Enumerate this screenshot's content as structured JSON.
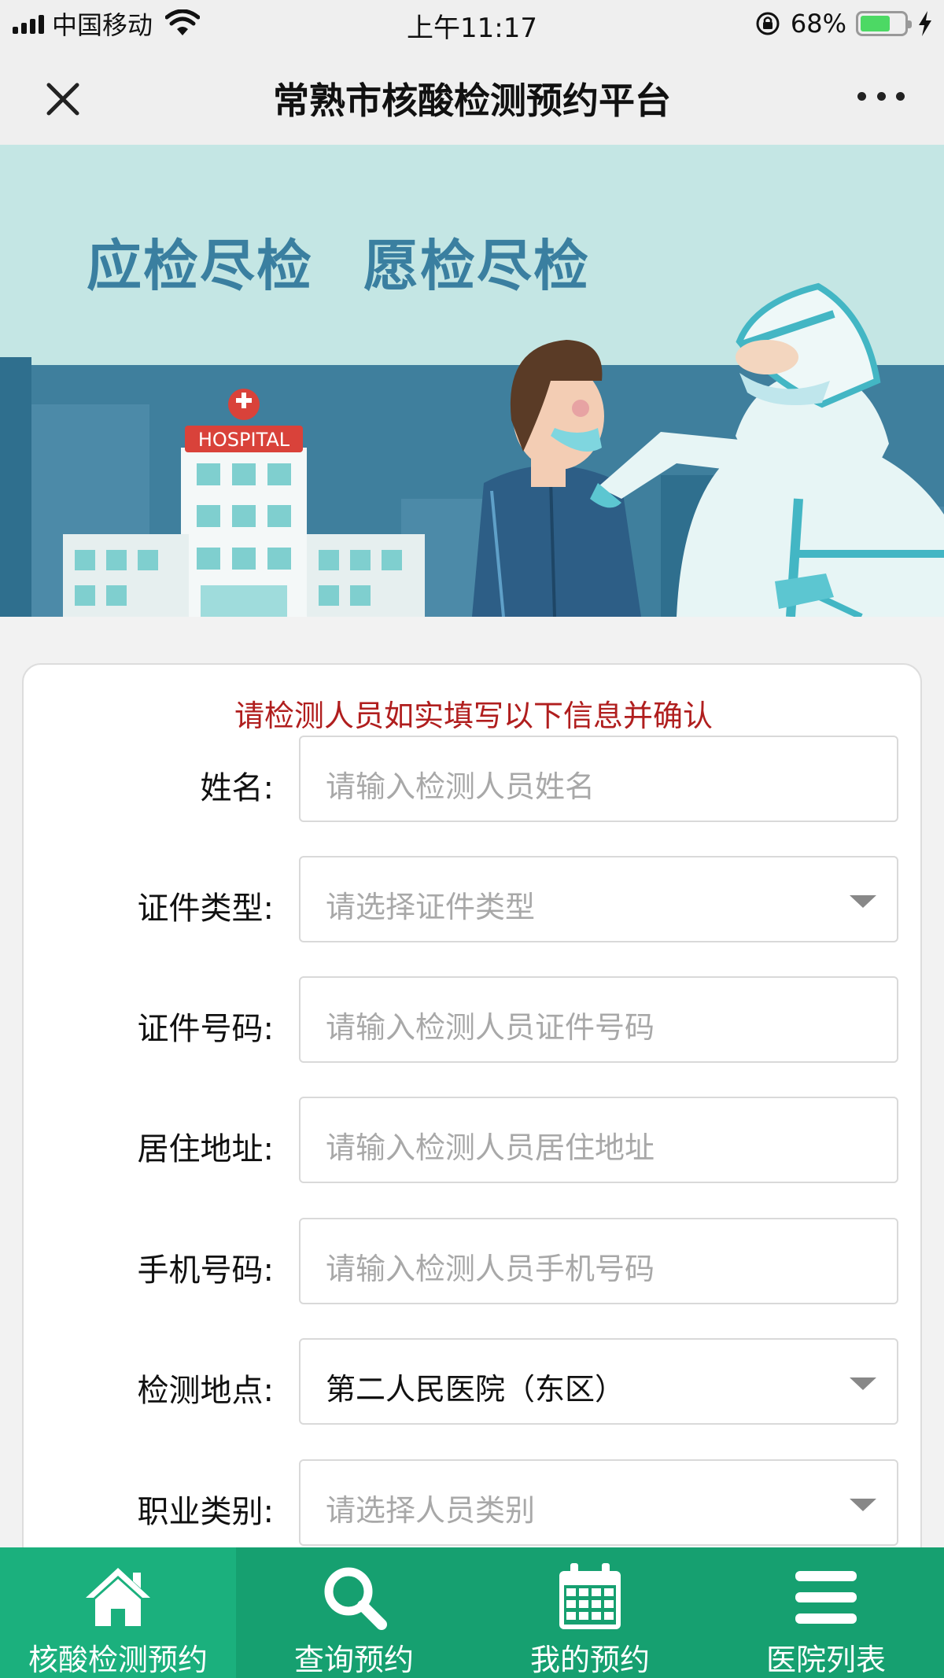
{
  "status_bar": {
    "carrier": "中国移动",
    "time": "上午11:17",
    "battery_percent": "68%",
    "battery_level": 0.68
  },
  "header": {
    "title": "常熟市核酸检测预约平台",
    "close_icon": "close-icon",
    "more_icon": "more-icon"
  },
  "banner": {
    "slogan_left": "应检尽检",
    "slogan_right": "愿检尽检",
    "hospital_sign": "HOSPITAL"
  },
  "form": {
    "notice": "请检测人员如实填写以下信息并确认",
    "fields": [
      {
        "label": "姓名:",
        "placeholder": "请输入检测人员姓名",
        "value": "",
        "type": "text"
      },
      {
        "label": "证件类型:",
        "placeholder": "请选择证件类型",
        "value": "",
        "type": "select"
      },
      {
        "label": "证件号码:",
        "placeholder": "请输入检测人员证件号码",
        "value": "",
        "type": "text"
      },
      {
        "label": "居住地址:",
        "placeholder": "请输入检测人员居住地址",
        "value": "",
        "type": "text"
      },
      {
        "label": "手机号码:",
        "placeholder": "请输入检测人员手机号码",
        "value": "",
        "type": "text"
      },
      {
        "label": "检测地点:",
        "placeholder": "",
        "value": "第二人民医院（东区）",
        "type": "select"
      },
      {
        "label": "职业类别:",
        "placeholder": "请选择人员类别",
        "value": "",
        "type": "select"
      }
    ]
  },
  "bottom_nav": {
    "items": [
      {
        "label": "核酸检测预约",
        "icon": "home-icon",
        "active": true
      },
      {
        "label": "查询预约",
        "icon": "search-icon",
        "active": false
      },
      {
        "label": "我的预约",
        "icon": "calendar-icon",
        "active": false
      },
      {
        "label": "医院列表",
        "icon": "list-icon",
        "active": false
      }
    ]
  },
  "colors": {
    "nav_green": "#16a070",
    "nav_active": "#1bb07d",
    "notice_red": "#b01e1e",
    "slogan_blue": "#3a7fa0"
  }
}
